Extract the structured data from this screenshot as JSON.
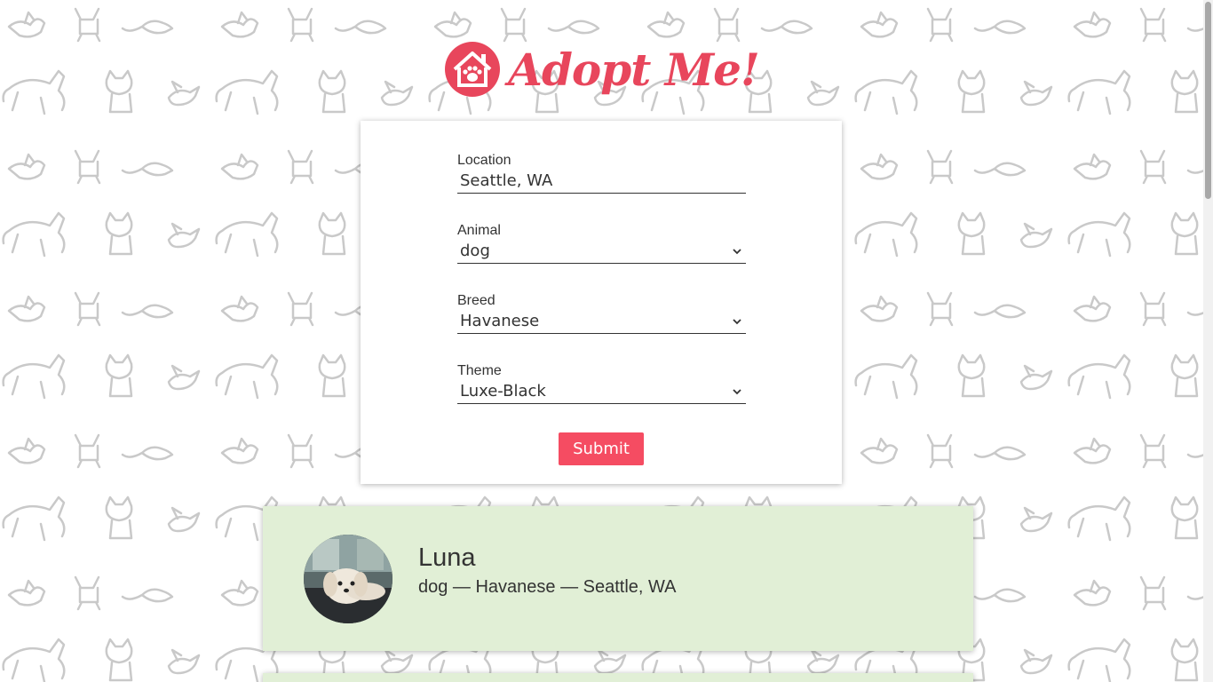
{
  "header": {
    "logo_text": "Adopt Me!",
    "logo_icon": "house-paw-icon"
  },
  "search_form": {
    "location": {
      "label": "Location",
      "value": "Seattle, WA"
    },
    "animal": {
      "label": "Animal",
      "value": "dog"
    },
    "breed": {
      "label": "Breed",
      "value": "Havanese"
    },
    "theme": {
      "label": "Theme",
      "value": "Luxe-Black"
    },
    "submit_label": "Submit"
  },
  "results": [
    {
      "name": "Luna",
      "info": "dog — Havanese — Seattle, WA"
    }
  ],
  "colors": {
    "brand": "#e8465c",
    "submit_bg": "#f54c62",
    "result_bg": "#e1efd6",
    "pattern": "#c8c8c8"
  }
}
